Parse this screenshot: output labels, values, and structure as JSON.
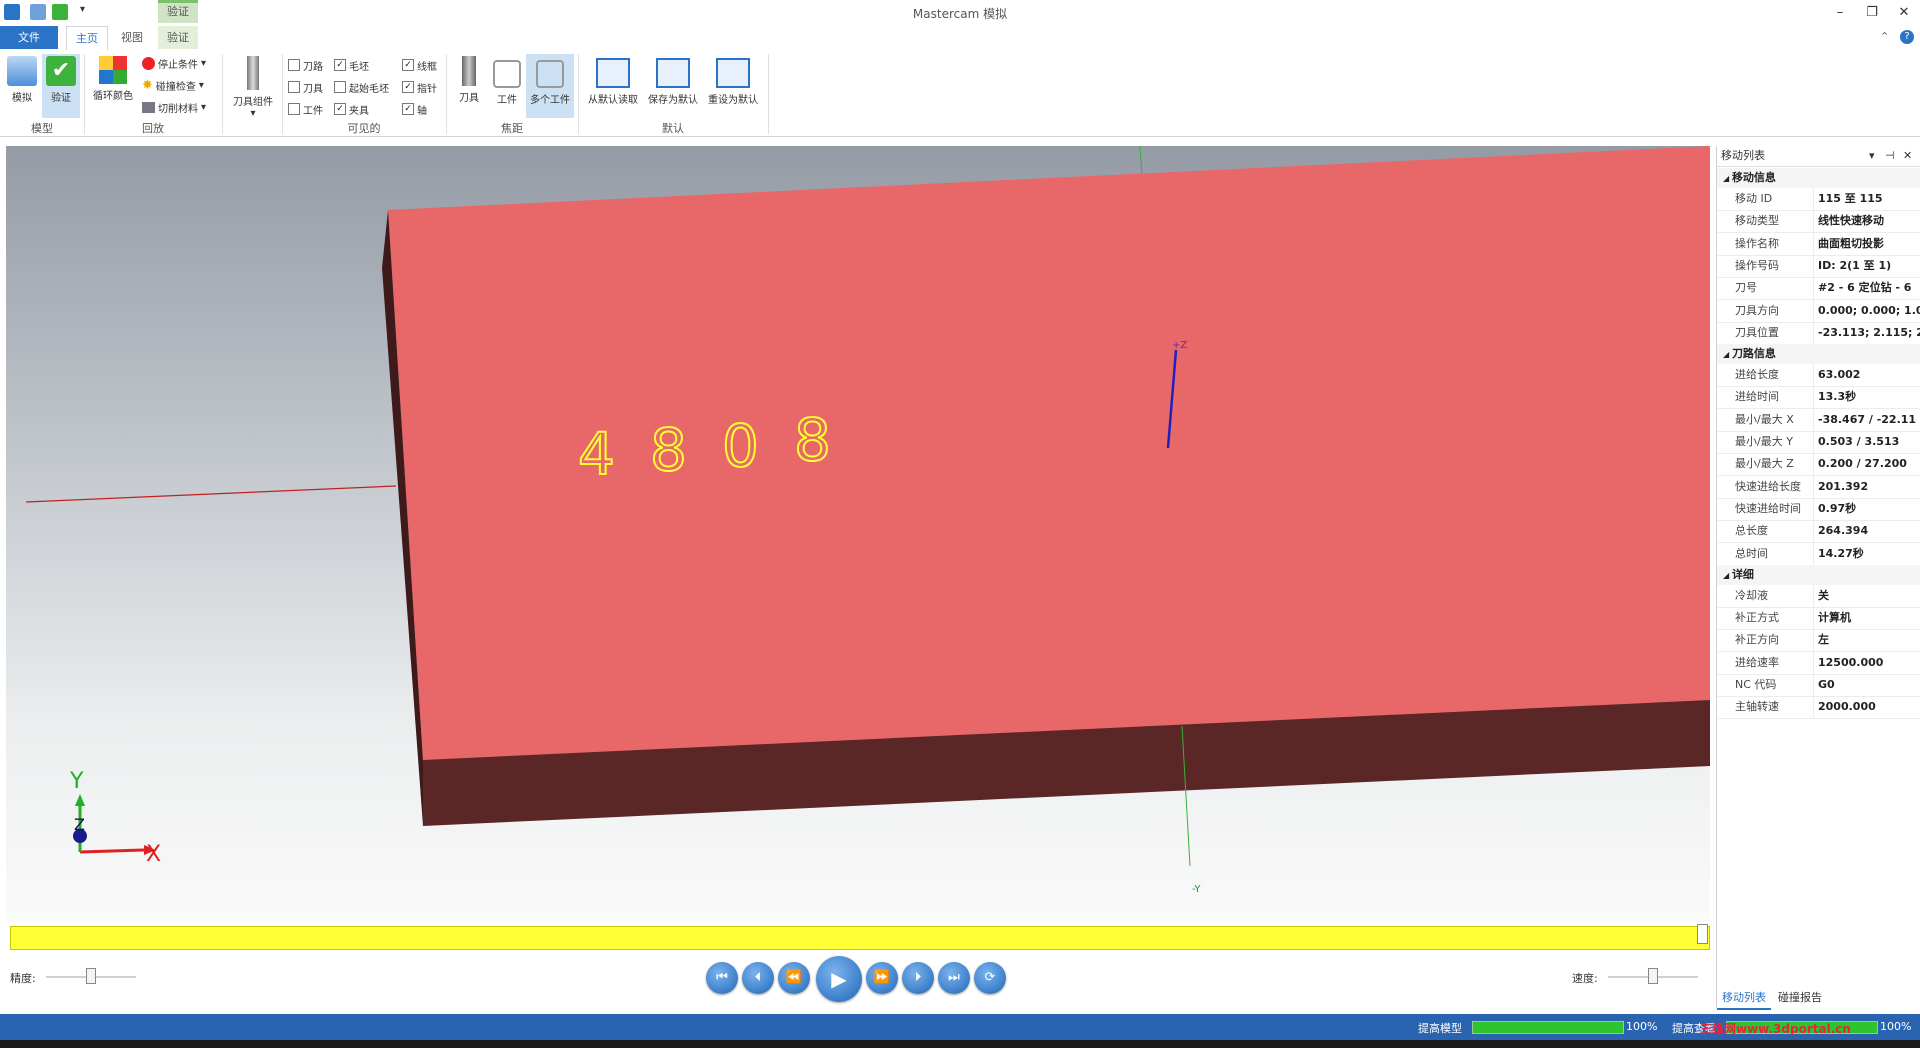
{
  "window": {
    "title": "Mastercam 模拟",
    "context_tab_group": "验证"
  },
  "tabs": {
    "file": "文件",
    "home": "主页",
    "view": "视图",
    "verify": "验证"
  },
  "ribbon": {
    "model": {
      "label": "模型",
      "simulate": "模拟",
      "verify": "验证"
    },
    "playback": {
      "label": "回放",
      "cycle_colors": "循环颜色",
      "stop_conditions": "停止条件",
      "collision_check": "碰撞检查",
      "cut_material": "切削材料"
    },
    "tool_component": {
      "label": "刀具组件"
    },
    "visible": {
      "label": "可见的",
      "toolpath": "刀路",
      "stock": "毛坯",
      "wireframe": "线框",
      "tool": "刀具",
      "initial_stock": "起始毛坯",
      "pointer": "指针",
      "workpiece": "工件",
      "fixture": "夹具",
      "axis": "轴"
    },
    "focus": {
      "label": "焦距",
      "tool": "刀具",
      "workpiece": "工件",
      "multi_workpiece": "多个工件"
    },
    "defaults": {
      "label": "默认",
      "read_default": "从默认读取",
      "save_default": "保存为默认",
      "reset_default": "重设为默认"
    }
  },
  "viewport": {
    "engraving_text": [
      "4",
      "8",
      "0",
      "8"
    ],
    "axis_plus_z": "+Z",
    "axis_minus_y": "-Y",
    "triad_x": "X",
    "triad_y": "Y",
    "triad_z": "Z",
    "colors": {
      "stock_top": "#e8686a",
      "stock_side": "#5a2626",
      "engraving": "#ffff33"
    }
  },
  "controls": {
    "precision_label": "精度:",
    "speed_label": "速度:",
    "play_icon": "play-icon"
  },
  "move_list": {
    "title": "移动列表",
    "sections": [
      {
        "name": "移动信息",
        "rows": [
          {
            "k": "移动 ID",
            "v": "115 至 115"
          },
          {
            "k": "移动类型",
            "v": "线性快速移动"
          },
          {
            "k": "操作名称",
            "v": "曲面粗切投影"
          },
          {
            "k": "操作号码",
            "v": "ID: 2(1 至 1)"
          },
          {
            "k": "刀号",
            "v": "#2 - 6 定位钻 - 6"
          },
          {
            "k": "刀具方向",
            "v": "0.000; 0.000; 1.0"
          },
          {
            "k": "刀具位置",
            "v": "-23.113; 2.115; 2"
          }
        ]
      },
      {
        "name": "刀路信息",
        "rows": [
          {
            "k": "进给长度",
            "v": "63.002"
          },
          {
            "k": "进给时间",
            "v": "13.3秒"
          },
          {
            "k": "最小/最大 X",
            "v": "-38.467 / -22.11"
          },
          {
            "k": "最小/最大 Y",
            "v": "0.503 / 3.513"
          },
          {
            "k": "最小/最大 Z",
            "v": "0.200 / 27.200"
          },
          {
            "k": "快速进给长度",
            "v": "201.392"
          },
          {
            "k": "快速进给时间",
            "v": "0.97秒"
          },
          {
            "k": "总长度",
            "v": "264.394"
          },
          {
            "k": "总时间",
            "v": "14.27秒"
          }
        ]
      },
      {
        "name": "详细",
        "rows": [
          {
            "k": "冷却液",
            "v": "关"
          },
          {
            "k": "补正方式",
            "v": "计算机"
          },
          {
            "k": "补正方向",
            "v": "左"
          },
          {
            "k": "进给速率",
            "v": "12500.000"
          },
          {
            "k": "NC 代码",
            "v": "G0"
          },
          {
            "k": "主轴转速",
            "v": "2000.000"
          }
        ]
      }
    ],
    "bottom_tabs": [
      "移动列表",
      "碰撞报告"
    ]
  },
  "status": {
    "improve_model": "提高模型",
    "improve_model_pct": "100%",
    "improve_check": "提高查看",
    "improve_check_pct": "100%",
    "improve_model_progress": 1.0,
    "improve_check_progress": 1.0,
    "watermark": "三维网www.3dportal.cn"
  }
}
